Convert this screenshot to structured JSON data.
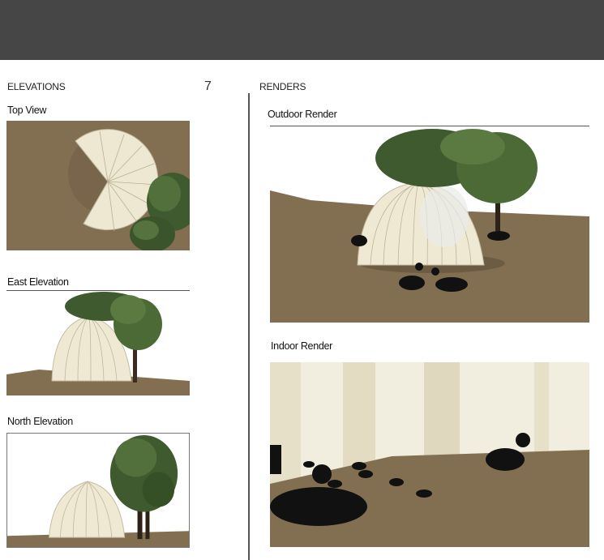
{
  "left": {
    "heading": "ELEVATIONS",
    "page_number": "7",
    "views": {
      "top": "Top View",
      "east": "East Elevation",
      "north": "North Elevation"
    }
  },
  "right": {
    "heading": "RENDERS",
    "outdoor": "Outdoor Render",
    "indoor": "Indoor Render"
  },
  "colors": {
    "header_bar": "#464646",
    "ground": "#826f52",
    "shell": "#efe9d4",
    "foliage": "#3f5a2e",
    "silhouette": "#111111"
  }
}
